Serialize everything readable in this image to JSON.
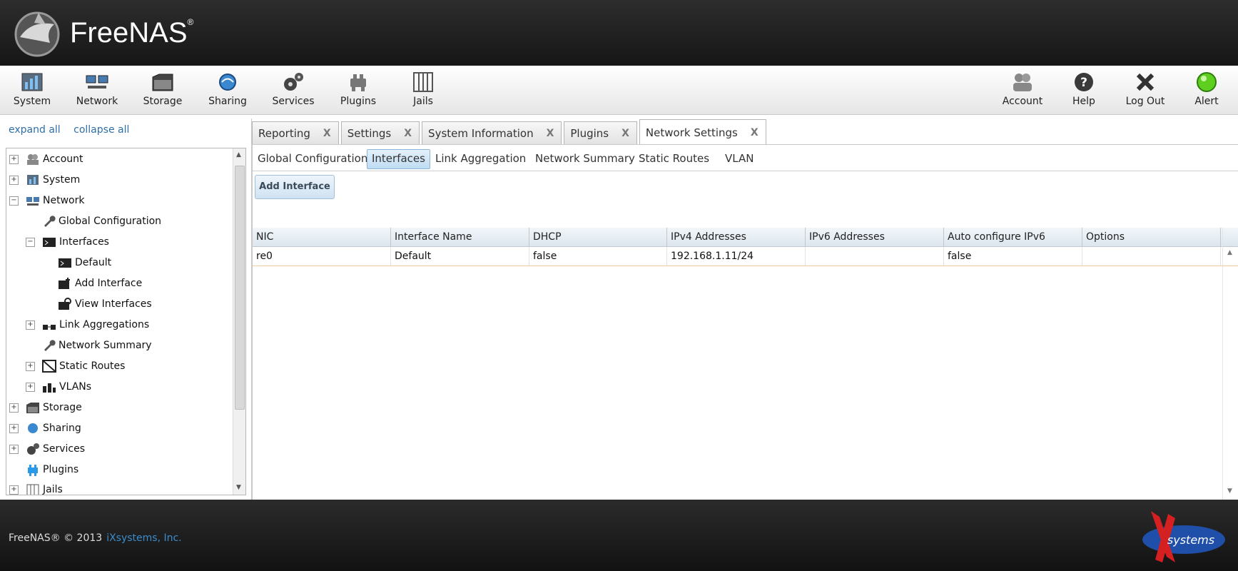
{
  "app": {
    "name": "FreeNAS",
    "trademark": "®"
  },
  "toolbar": {
    "left": [
      {
        "label": "System",
        "icon": "system-icon"
      },
      {
        "label": "Network",
        "icon": "network-icon"
      },
      {
        "label": "Storage",
        "icon": "storage-icon"
      },
      {
        "label": "Sharing",
        "icon": "sharing-icon"
      },
      {
        "label": "Services",
        "icon": "services-icon"
      },
      {
        "label": "Plugins",
        "icon": "plugins-icon"
      },
      {
        "label": "Jails",
        "icon": "jails-icon"
      }
    ],
    "right": [
      {
        "label": "Account",
        "icon": "account-icon"
      },
      {
        "label": "Help",
        "icon": "help-icon"
      },
      {
        "label": "Log Out",
        "icon": "logout-icon"
      },
      {
        "label": "Alert",
        "icon": "alert-icon"
      }
    ]
  },
  "tree": {
    "expand_all": "expand all",
    "collapse_all": "collapse all",
    "items": [
      {
        "label": "Account",
        "expander": "+",
        "icon": "account-icon"
      },
      {
        "label": "System",
        "expander": "+",
        "icon": "system-icon"
      },
      {
        "label": "Network",
        "expander": "−",
        "icon": "network-icon"
      },
      {
        "label": "Global Configuration",
        "expander": "",
        "icon": "wrench-icon"
      },
      {
        "label": "Interfaces",
        "expander": "−",
        "icon": "interface-icon"
      },
      {
        "label": "Default",
        "expander": "",
        "icon": "interface-icon"
      },
      {
        "label": "Add Interface",
        "expander": "",
        "icon": "add-interface-icon"
      },
      {
        "label": "View Interfaces",
        "expander": "",
        "icon": "view-interfaces-icon"
      },
      {
        "label": "Link Aggregations",
        "expander": "+",
        "icon": "link-aggregation-icon"
      },
      {
        "label": "Network Summary",
        "expander": "",
        "icon": "wrench-icon"
      },
      {
        "label": "Static Routes",
        "expander": "+",
        "icon": "static-routes-icon"
      },
      {
        "label": "VLANs",
        "expander": "+",
        "icon": "vlan-icon"
      },
      {
        "label": "Storage",
        "expander": "+",
        "icon": "storage-icon"
      },
      {
        "label": "Sharing",
        "expander": "+",
        "icon": "sharing-icon"
      },
      {
        "label": "Services",
        "expander": "+",
        "icon": "services-icon"
      },
      {
        "label": "Plugins",
        "expander": "",
        "icon": "plugins-icon"
      },
      {
        "label": "Jails",
        "expander": "+",
        "icon": "jails-icon"
      }
    ]
  },
  "tabs": [
    {
      "label": "Reporting",
      "close": "X"
    },
    {
      "label": "Settings",
      "close": "X"
    },
    {
      "label": "System Information",
      "close": "X"
    },
    {
      "label": "Plugins",
      "close": "X"
    },
    {
      "label": "Network Settings",
      "close": "X"
    }
  ],
  "subtabs": [
    "Global Configuration",
    "Interfaces",
    "Link Aggregation",
    "Network Summary",
    "Static Routes",
    "VLAN"
  ],
  "add_interface_label": "Add Interface",
  "grid": {
    "columns": [
      "NIC",
      "Interface Name",
      "DHCP",
      "IPv4 Addresses",
      "IPv6 Addresses",
      "Auto configure IPv6",
      "Options"
    ],
    "rows": [
      [
        "re0",
        "Default",
        "false",
        "192.168.1.11/24",
        "",
        "false",
        ""
      ]
    ]
  },
  "footer": {
    "copyright": "FreeNAS® © 2013",
    "company": "iXsystems, Inc.",
    "logo_text": "systems"
  },
  "colors": {
    "header_bg": "#1e1e1e",
    "link": "#2f6fa8",
    "active_subtab": "#bfdcf2",
    "row_border": "#f0c9a5"
  }
}
